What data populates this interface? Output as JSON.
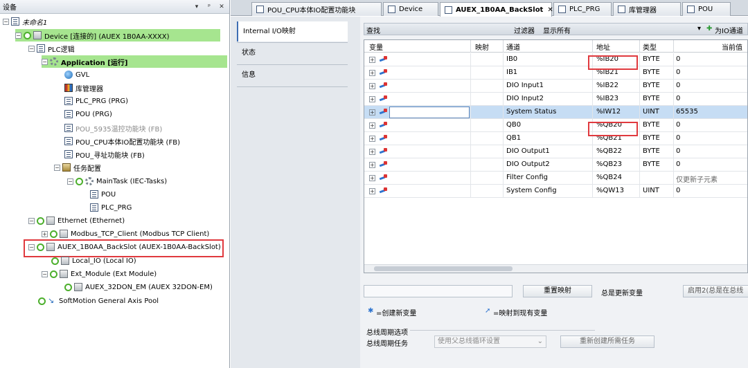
{
  "left_panel": {
    "title": "设备",
    "btn_dropdown": "▾",
    "btn_pin": "ᵖ",
    "btn_close": "✕",
    "tree": [
      {
        "label": "未命名1"
      },
      {
        "label": "Device [连接的] (AUEX 1B0AA-XXXX)"
      },
      {
        "label": "PLC逻辑"
      },
      {
        "label": "Application [运行]"
      },
      {
        "label": "GVL"
      },
      {
        "label": "库管理器"
      },
      {
        "label": "PLC_PRG (PRG)"
      },
      {
        "label": "POU (PRG)"
      },
      {
        "label": "POU_5935温控功能块 (FB)"
      },
      {
        "label": "POU_CPU本体IO配置功能块 (FB)"
      },
      {
        "label": "POU_寻址功能块 (FB)"
      },
      {
        "label": "任务配置"
      },
      {
        "label": "MainTask (IEC-Tasks)"
      },
      {
        "label": "POU"
      },
      {
        "label": "PLC_PRG"
      },
      {
        "label": "Ethernet (Ethernet)"
      },
      {
        "label": "Modbus_TCP_Client (Modbus TCP Client)"
      },
      {
        "label": "AUEX_1B0AA_BackSlot (AUEX-1B0AA-BackSlot)"
      },
      {
        "label": "Local_IO (Local IO)"
      },
      {
        "label": "Ext_Module (Ext Module)"
      },
      {
        "label": "AUEX_32DON_EM (AUEX 32DON-EM)"
      },
      {
        "label": "SoftMotion General Axis Pool"
      }
    ]
  },
  "tabs": [
    {
      "label": "POU_CPU本体IO配置功能块"
    },
    {
      "label": "Device"
    },
    {
      "label": "AUEX_1B0AA_BackSlot",
      "close": "✕"
    },
    {
      "label": "PLC_PRG"
    },
    {
      "label": "库管理器"
    },
    {
      "label": "POU"
    }
  ],
  "side_nav": [
    {
      "label": "Internal I/O映射"
    },
    {
      "label": "状态"
    },
    {
      "label": "信息"
    }
  ],
  "filter_bar": {
    "search_label": "查找",
    "filter_label": "过滤器",
    "filter_value": "显示所有",
    "add_fb": "为IO通道"
  },
  "grid": {
    "headers": [
      "变量",
      "映射",
      "通道",
      "地址",
      "类型",
      "当前值"
    ],
    "rows": [
      {
        "channel": "IB0",
        "address": "%IB20",
        "type": "BYTE",
        "value": "0"
      },
      {
        "channel": "IB1",
        "address": "%IB21",
        "type": "BYTE",
        "value": "0"
      },
      {
        "channel": "DIO Input1",
        "address": "%IB22",
        "type": "BYTE",
        "value": "0"
      },
      {
        "channel": "DIO Input2",
        "address": "%IB23",
        "type": "BYTE",
        "value": "0"
      },
      {
        "channel": "System Status",
        "address": "%IW12",
        "type": "UINT",
        "value": "65535"
      },
      {
        "channel": "QB0",
        "address": "%QB20",
        "type": "BYTE",
        "value": "0"
      },
      {
        "channel": "QB1",
        "address": "%QB21",
        "type": "BYTE",
        "value": "0"
      },
      {
        "channel": "DIO Output1",
        "address": "%QB22",
        "type": "BYTE",
        "value": "0"
      },
      {
        "channel": "DIO Output2",
        "address": "%QB23",
        "type": "BYTE",
        "value": "0"
      },
      {
        "channel": "Filter Config",
        "address": "%QB24",
        "type": "",
        "value": "仅更新子元素"
      },
      {
        "channel": "System Config",
        "address": "%QW13",
        "type": "UINT",
        "value": "0"
      }
    ]
  },
  "bottom": {
    "reset_mapping": "重置映射",
    "always_update": "总是更新变量",
    "enable_text": "启用2(总是在总线",
    "create_new": "=创建新变量",
    "map_existing": "=映射到现有变量",
    "bus_cycle_group": "总线周期选项",
    "bus_cycle_task_label": "总线周期任务",
    "bus_cycle_task_value": "使用父总线循环设置",
    "recreate_task": "重新创建所需任务"
  }
}
